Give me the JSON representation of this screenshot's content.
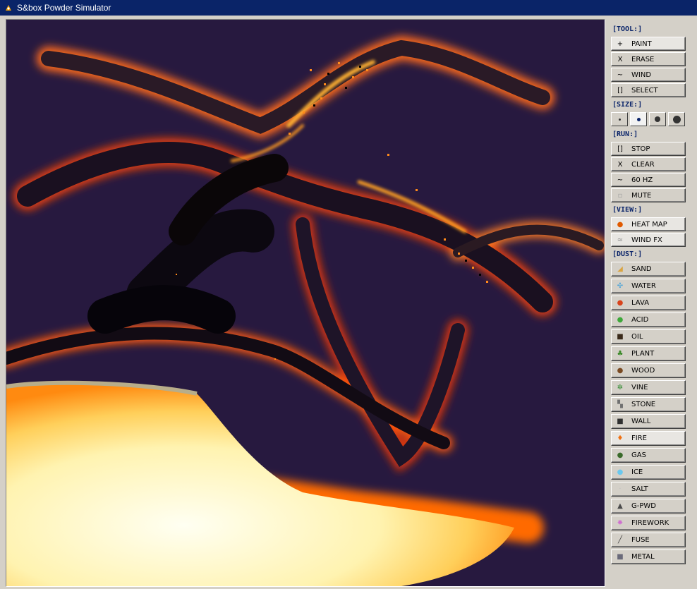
{
  "window": {
    "title": "S&box Powder Simulator"
  },
  "colors": {
    "titlebar": "#0a2468",
    "header": "#0a246a",
    "background": "#27193f",
    "hot": "#fffde0",
    "glow": "#ff6a00"
  },
  "panel": {
    "tool": {
      "header": "[TOOL:]",
      "items": [
        {
          "label": "PAINT",
          "icon": "+",
          "icon_name": "plus-icon",
          "active": true
        },
        {
          "label": "ERASE",
          "icon": "X",
          "icon_name": "x-icon",
          "active": false
        },
        {
          "label": "WIND",
          "icon": "~",
          "icon_name": "wave-icon",
          "active": false
        },
        {
          "label": "SELECT",
          "icon": "[]",
          "icon_name": "bracket-icon",
          "active": false
        }
      ]
    },
    "size": {
      "header": "[SIZE:]",
      "selected_index": 1
    },
    "run": {
      "header": "[RUN:]",
      "items": [
        {
          "label": "STOP",
          "icon": "[]",
          "icon_name": "stop-icon"
        },
        {
          "label": "CLEAR",
          "icon": "X",
          "icon_name": "x-icon"
        },
        {
          "label": "60 HZ",
          "icon": "~",
          "icon_name": "wave-icon"
        },
        {
          "label": "MUTE",
          "icon": "▫",
          "icon_name": "mute-icon"
        }
      ]
    },
    "view": {
      "header": "[VIEW:]",
      "items": [
        {
          "label": "HEAT MAP",
          "icon": "●",
          "icon_name": "flame-icon",
          "color": "#e05a00",
          "active": true
        },
        {
          "label": "WIND FX",
          "icon": "≈",
          "icon_name": "wind-icon",
          "color": "#8a8a8a",
          "active": true
        }
      ]
    },
    "dust": {
      "header": "[DUST:]",
      "items": [
        {
          "label": "SAND",
          "icon": "◢",
          "icon_name": "sand-icon",
          "color": "#d9a441"
        },
        {
          "label": "WATER",
          "icon": "✣",
          "icon_name": "water-icon",
          "color": "#4aa3d8"
        },
        {
          "label": "LAVA",
          "icon": "●",
          "icon_name": "lava-icon",
          "color": "#d8431c"
        },
        {
          "label": "ACID",
          "icon": "●",
          "icon_name": "acid-icon",
          "color": "#3ea83a"
        },
        {
          "label": "OIL",
          "icon": "■",
          "icon_name": "oil-icon",
          "color": "#3a2a1a"
        },
        {
          "label": "PLANT",
          "icon": "♣",
          "icon_name": "plant-icon",
          "color": "#3c8a2a"
        },
        {
          "label": "WOOD",
          "icon": "●",
          "icon_name": "wood-icon",
          "color": "#7a4a22"
        },
        {
          "label": "VINE",
          "icon": "✲",
          "icon_name": "vine-icon",
          "color": "#2f8a2f"
        },
        {
          "label": "STONE",
          "icon": "▚",
          "icon_name": "stone-icon",
          "color": "#707070"
        },
        {
          "label": "WALL",
          "icon": "■",
          "icon_name": "wall-icon",
          "color": "#303030"
        },
        {
          "label": "FIRE",
          "icon": "♦",
          "icon_name": "fire-icon",
          "color": "#f07010",
          "active": true
        },
        {
          "label": "GAS",
          "icon": "●",
          "icon_name": "gas-icon",
          "color": "#3a6a2a"
        },
        {
          "label": "ICE",
          "icon": "●",
          "icon_name": "ice-icon",
          "color": "#6ac8ee"
        },
        {
          "label": "SALT",
          "icon": "·",
          "icon_name": "salt-icon",
          "color": "#bfbfbf"
        },
        {
          "label": "G-PWD",
          "icon": "▲",
          "icon_name": "gunpowder-icon",
          "color": "#4a4a4a"
        },
        {
          "label": "FIREWORK",
          "icon": "✸",
          "icon_name": "firework-icon",
          "color": "#d070d0"
        },
        {
          "label": "FUSE",
          "icon": "╱",
          "icon_name": "fuse-icon",
          "color": "#404040"
        },
        {
          "label": "METAL",
          "icon": "■",
          "icon_name": "metal-icon",
          "color": "#6a6a7a"
        }
      ]
    }
  }
}
